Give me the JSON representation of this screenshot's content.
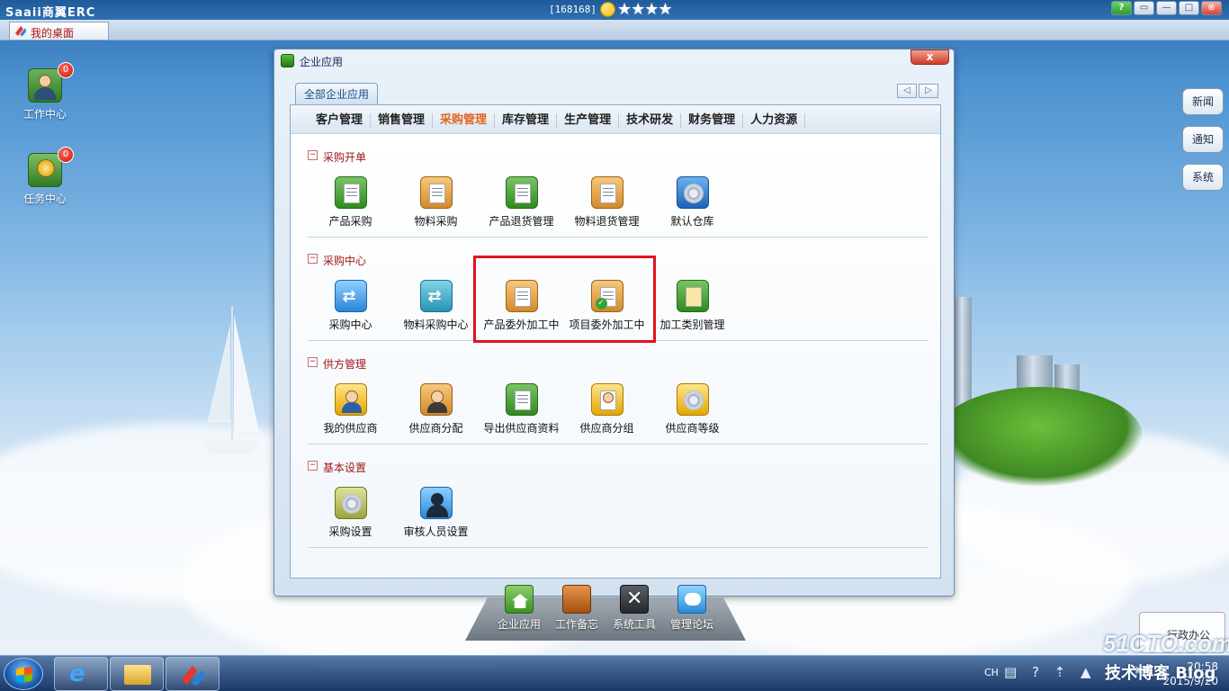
{
  "topbar": {
    "app_title": "Saaii商翼ERC",
    "user_id": "[168168]",
    "stars": "★★★★",
    "buttons": [
      "?",
      "▭",
      "—",
      "□",
      "⊗"
    ]
  },
  "tabstrip": {
    "desk_tab": "我的桌面"
  },
  "desktop": {
    "icons": [
      {
        "label": "工作中心",
        "badge": "0"
      },
      {
        "label": "任务中心",
        "badge": "0"
      }
    ],
    "side_buttons": [
      "新闻",
      "通知",
      "系统"
    ],
    "xingzheng": "行政办公"
  },
  "window": {
    "title": "企业应用",
    "close": "x",
    "tab_all": "全部企业应用",
    "nav_prev": "◁",
    "nav_next": "▷",
    "categories": [
      "客户管理",
      "销售管理",
      "采购管理",
      "库存管理",
      "生产管理",
      "技术研发",
      "财务管理",
      "人力资源"
    ],
    "active_category": "采购管理",
    "sections": [
      {
        "title": "采购开单",
        "items": [
          "产品采购",
          "物料采购",
          "产品退货管理",
          "物料退货管理",
          "默认仓库"
        ]
      },
      {
        "title": "采购中心",
        "items": [
          "采购中心",
          "物料采购中心",
          "产品委外加工中",
          "项目委外加工中",
          "加工类别管理"
        ]
      },
      {
        "title": "供方管理",
        "items": [
          "我的供应商",
          "供应商分配",
          "导出供应商资料",
          "供应商分组",
          "供应商等级"
        ]
      },
      {
        "title": "基本设置",
        "items": [
          "采购设置",
          "审核人员设置"
        ]
      }
    ]
  },
  "dock": {
    "items": [
      "企业应用",
      "工作备忘",
      "系统工具",
      "管理论坛"
    ]
  },
  "taskbar": {
    "lang": "CH",
    "tray_icons": "▤ ? ⇡ ▲ ⚑ ⚑ ▮",
    "time": "20:58",
    "date": "2015/9/20"
  },
  "watermark": {
    "line1": "51CTO.com",
    "line2": "技术博客 Blog"
  },
  "colors": {
    "accent_red": "#e0141c",
    "active_cat": "#e2641c",
    "section_title": "#a01818"
  }
}
